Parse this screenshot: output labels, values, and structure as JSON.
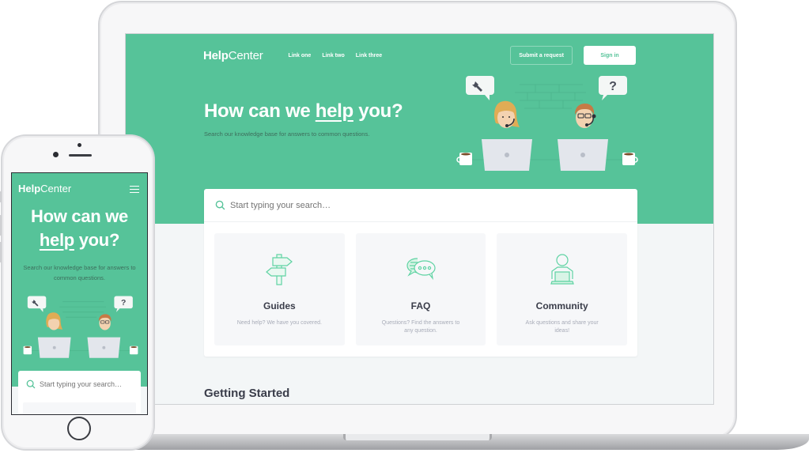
{
  "brand": {
    "bold": "Help",
    "regular": "Center",
    "accent": "#56c399",
    "text_dark": "#3a3d4a"
  },
  "nav": {
    "links": [
      {
        "label": "Link one"
      },
      {
        "label": "Link two"
      },
      {
        "label": "Link three"
      }
    ],
    "submit_label": "Submit a request",
    "signin_label": "Sign in"
  },
  "hero": {
    "title_before": "How can we ",
    "title_emph": "help",
    "title_after": " you?",
    "subtitle": "Search our knowledge base for answers to common questions."
  },
  "search": {
    "placeholder": "Start typing your search…",
    "icon": "search-icon"
  },
  "cards": [
    {
      "icon": "signpost-icon",
      "title": "Guides",
      "desc": "Need help? We have you covered."
    },
    {
      "icon": "chat-bubbles-icon",
      "title": "FAQ",
      "desc": "Questions? Find the answers to any question."
    },
    {
      "icon": "person-laptop-icon",
      "title": "Community",
      "desc": "Ask questions and share your ideas!"
    }
  ],
  "section": {
    "getting_started": "Getting Started"
  },
  "illustration": {
    "left_bubble": "wrench-icon",
    "right_bubble": "?"
  },
  "mobile": {
    "title_line1": "How can we",
    "title_emph": "help",
    "title_after": " you?",
    "subtitle": "Search our knowledge base for answers to common questions.",
    "menu_icon": "hamburger-icon"
  }
}
